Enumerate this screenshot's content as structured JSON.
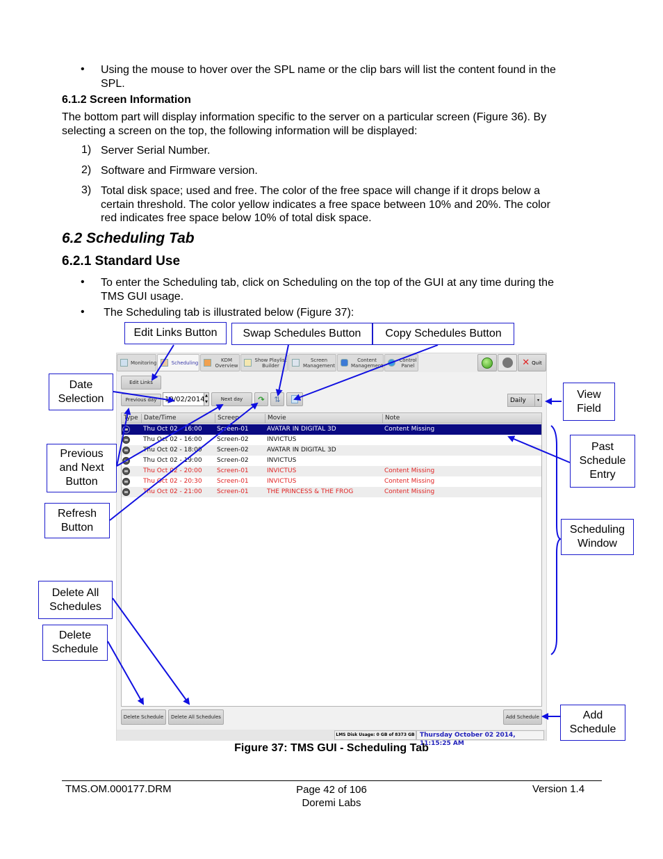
{
  "document": {
    "bullet_spl": "Using the mouse to hover over the SPL name or the clip bars will list the content found in the SPL.",
    "bullet_spl_line1": "Using the mouse to hover over the SPL name or the clip bars will list the content found in the",
    "bullet_spl_line2": "SPL.",
    "heading_612": "6.1.2  Screen Information",
    "para_line1": "The bottom part will display information specific to the server on a particular screen (Figure 36).  By",
    "para_line2": "selecting a screen on the top, the following information will be displayed:",
    "list": [
      {
        "num": "1)",
        "line1": "Server Serial Number.",
        "line2": "",
        "line3": ""
      },
      {
        "num": "2)",
        "line1": "Software and Firmware version.",
        "line2": "",
        "line3": ""
      },
      {
        "num": "3)",
        "line1": "Total disk space; used and free. The color of the free space will change if it drops below a",
        "line2": "certain threshold. The color yellow indicates a free space between 10% and 20%. The color",
        "line3": "red indicates free space below 10% of total disk space."
      }
    ],
    "heading_62": "6.2  Scheduling Tab",
    "heading_621": "6.2.1  Standard Use",
    "bullet_enter_line1": "To enter the Scheduling tab, click on Scheduling on the top of the GUI at any time during the",
    "bullet_enter_line2": "TMS GUI usage.",
    "bullet_illustrated": " The Scheduling tab is illustrated below (Figure 37):",
    "bullet_char": "•",
    "caption": "Figure 37: TMS GUI - Scheduling Tab",
    "footer": {
      "left": "TMS.OM.000177.DRM",
      "center_line1": "Page 42 of 106",
      "center_line2": "Doremi Labs",
      "right": "Version 1.4"
    }
  },
  "gui": {
    "tabs": [
      {
        "line1": "Monitoring",
        "line2": "",
        "active": false
      },
      {
        "line1": "Scheduling",
        "line2": "",
        "active": true
      },
      {
        "line1": "KDM",
        "line2": "Overview",
        "active": false
      },
      {
        "line1": "Show Playlist",
        "line2": "Builder",
        "active": false
      },
      {
        "line1": "Screen",
        "line2": "Management",
        "active": false
      },
      {
        "line1": "Content",
        "line2": "Management",
        "active": false
      },
      {
        "line1": "Control",
        "line2": "Panel",
        "active": false
      }
    ],
    "quit_label": "Quit",
    "edit_links_label": "Edit Links",
    "previous_day_label": "Previous day",
    "date_value": "10/02/2014",
    "next_day_label": "Next day",
    "view_select_value": "Daily",
    "columns": [
      "Type",
      "Date/Time",
      "Screen",
      "Movie",
      "Note"
    ],
    "rows": [
      {
        "datetime": "Thu Oct 02 - 16:00",
        "screen": "Screen-01",
        "movie": "AVATAR IN DIGITAL 3D",
        "note": "Content Missing",
        "state": "selected"
      },
      {
        "datetime": "Thu Oct 02 - 16:00",
        "screen": "Screen-02",
        "movie": "INVICTUS",
        "note": "",
        "state": "normal"
      },
      {
        "datetime": "Thu Oct 02 - 18:00",
        "screen": "Screen-02",
        "movie": "AVATAR IN DIGITAL 3D",
        "note": "",
        "state": "normal"
      },
      {
        "datetime": "Thu Oct 02 - 19:00",
        "screen": "Screen-02",
        "movie": "INVICTUS",
        "note": "",
        "state": "normal"
      },
      {
        "datetime": "Thu Oct 02 - 20:00",
        "screen": "Screen-01",
        "movie": "INVICTUS",
        "note": "Content Missing",
        "state": "missing"
      },
      {
        "datetime": "Thu Oct 02 - 20:30",
        "screen": "Screen-01",
        "movie": "INVICTUS",
        "note": "Content Missing",
        "state": "missing"
      },
      {
        "datetime": "Thu Oct 02 - 21:00",
        "screen": "Screen-01",
        "movie": "THE PRINCESS & THE FROG",
        "note": "Content Missing",
        "state": "missing"
      }
    ],
    "delete_schedule_label": "Delete Schedule",
    "delete_all_label": "Delete All Schedules",
    "add_schedule_label": "Add Schedule",
    "disk_usage": "LMS Disk Usage: 0 GB of 8373 GB",
    "clock": "Thursday October 02 2014, 11:15:25 AM",
    "colors": {
      "selected_row": "#0a0a82",
      "missing_text": "#e02424",
      "active_tab_text": "#3a3aa8",
      "clock_text": "#2222bb"
    }
  },
  "callouts": {
    "edit_links": "Edit Links Button",
    "swap": "Swap Schedules Button",
    "copy": "Copy Schedules Button",
    "date_selection_l1": "Date",
    "date_selection_l2": "Selection",
    "prev_next_l1": "Previous",
    "prev_next_l2": "and Next",
    "prev_next_l3": "Button",
    "refresh_l1": "Refresh",
    "refresh_l2": "Button",
    "delete_all_l1": "Delete All",
    "delete_all_l2": "Schedules",
    "delete_l1": "Delete",
    "delete_l2": "Schedule",
    "view_l1": "View",
    "view_l2": "Field",
    "past_l1": "Past",
    "past_l2": "Schedule",
    "past_l3": "Entry",
    "window_l1": "Scheduling",
    "window_l2": "Window",
    "add_l1": "Add",
    "add_l2": "Schedule",
    "color": "#1a1acc"
  }
}
